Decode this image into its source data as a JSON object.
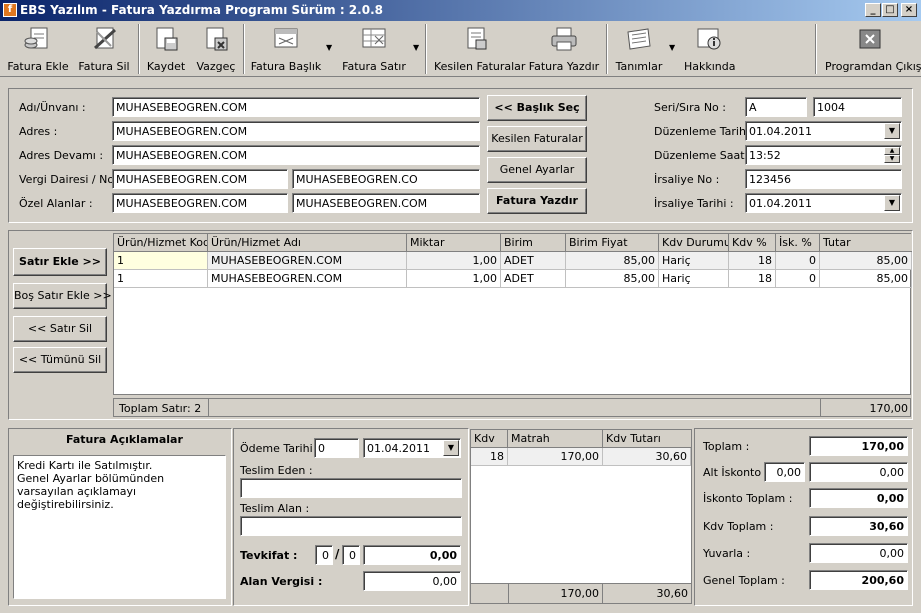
{
  "window": {
    "title": "EBS Yazılım - Fatura Yazdırma Programı Sürüm : 2.0.8"
  },
  "toolbar": [
    {
      "label": "Fatura Ekle",
      "icon": "add-invoice-icon"
    },
    {
      "label": "Fatura Sil",
      "icon": "delete-invoice-icon"
    },
    {
      "label": "Kaydet",
      "icon": "save-icon"
    },
    {
      "label": "Vazgeç",
      "icon": "cancel-icon"
    },
    {
      "label": "Fatura Başlık",
      "icon": "invoice-header-icon"
    },
    {
      "label": "Fatura Satır",
      "icon": "invoice-row-icon"
    },
    {
      "label": "Kesilen Faturalar",
      "icon": "issued-invoices-icon"
    },
    {
      "label": "Fatura Yazdır",
      "icon": "printer-icon"
    },
    {
      "label": "Tanımlar",
      "icon": "definitions-icon"
    },
    {
      "label": "Hakkında",
      "icon": "about-icon"
    },
    {
      "label": "Programdan Çıkış",
      "icon": "exit-icon"
    }
  ],
  "header": {
    "name_label": "Adı/Ünvanı :",
    "name_value": "MUHASEBEOGREN.COM",
    "address_label": "Adres :",
    "address_value": "MUHASEBEOGREN.COM",
    "address2_label": "Adres Devamı :",
    "address2_value": "MUHASEBEOGREN.COM",
    "tax_label": "Vergi Dairesi / No :",
    "tax_office": "MUHASEBEOGREN.COM",
    "tax_no": "MUHASEBEOGREN.CO",
    "custom_label": "Özel Alanlar :",
    "custom1": "MUHASEBEOGREN.COM",
    "custom2": "MUHASEBEOGREN.COM",
    "btn_header": "<< Başlık Seç",
    "btn_issued": "Kesilen Faturalar",
    "btn_settings": "Genel Ayarlar",
    "btn_print": "Fatura Yazdır",
    "serial_label": "Seri/Sıra No :",
    "serial": "A",
    "number": "1004",
    "issue_date_label": "Düzenleme Tarihi :",
    "issue_date": "01.04.2011",
    "issue_time_label": "Düzenleme Saati :",
    "issue_time": "13:52",
    "waybill_no_label": "İrsaliye No :",
    "waybill_no": "123456",
    "waybill_date_label": "İrsaliye Tarihi :",
    "waybill_date": "01.04.2011"
  },
  "rows_panel": {
    "add_row": "Satır Ekle >>",
    "add_empty_row": "Boş Satır Ekle >>",
    "delete_row": "<< Satır Sil",
    "delete_all": "<< Tümünü Sil",
    "columns": [
      "Ürün/Hizmet Kodu",
      "Ürün/Hizmet Adı",
      "Miktar",
      "Birim",
      "Birim Fiyat",
      "Kdv Durumu",
      "Kdv %",
      "İsk. %",
      "Tutar"
    ],
    "rows": [
      [
        "1",
        "MUHASEBEOGREN.COM",
        "1,00",
        "ADET",
        "85,00",
        "Hariç",
        "18",
        "0",
        "85,00"
      ],
      [
        "1",
        "MUHASEBEOGREN.COM",
        "1,00",
        "ADET",
        "85,00",
        "Hariç",
        "18",
        "0",
        "85,00"
      ]
    ],
    "total_rows": "Toplam Satır: 2",
    "total_amount": "170,00"
  },
  "notes": {
    "title": "Fatura Açıklamalar",
    "text": "Kredi Kartı ile Satılmıştır.\nGenel Ayarlar bölümünden varsayılan açıklamayı değiştirebilirsiniz."
  },
  "payment": {
    "due_label": "Ödeme Tarihi :",
    "due_days": "0",
    "due_date": "01.04.2011",
    "delivered_by_label": "Teslim Eden :",
    "received_by_label": "Teslim Alan :",
    "withholding_label": "Tevkifat :",
    "withholding_a": "0",
    "withholding_sep": "/",
    "withholding_b": "0",
    "withholding_amount": "0,00",
    "buyer_tax_label": "Alan Vergisi :",
    "buyer_tax": "0,00"
  },
  "vat_table": {
    "columns": [
      "Kdv",
      "Matrah",
      "Kdv Tutarı"
    ],
    "rows": [
      [
        "18",
        "170,00",
        "30,60"
      ]
    ],
    "footer_base": "170,00",
    "footer_vat": "30,60"
  },
  "totals": {
    "total_label": "Toplam :",
    "total": "170,00",
    "sub_discount_label": "Alt İskonto :",
    "sub_discount_rate": "0,00",
    "sub_discount": "0,00",
    "discount_total_label": "İskonto Toplam :",
    "discount_total": "0,00",
    "vat_total_label": "Kdv Toplam :",
    "vat_total": "30,60",
    "round_label": "Yuvarla :",
    "round": "0,00",
    "grand_total_label": "Genel Toplam :",
    "grand_total": "200,60"
  }
}
